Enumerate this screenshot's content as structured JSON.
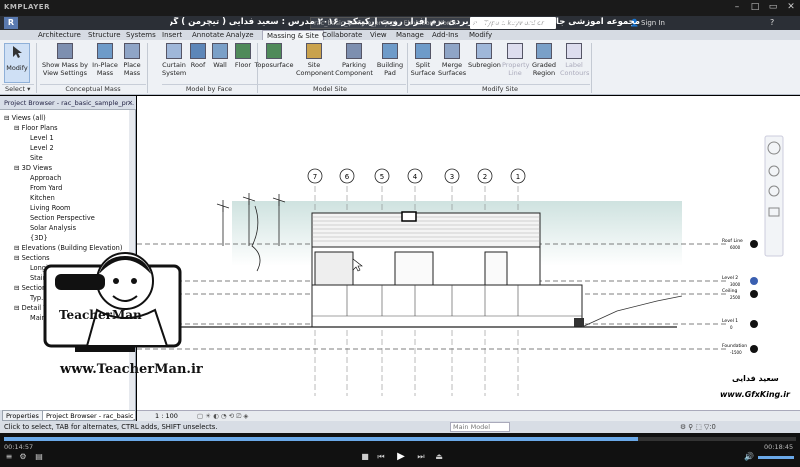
{
  "player": {
    "logo": "KMPLAYER",
    "elapsed": "00:14:57",
    "total": "00:18:45",
    "progress_fraction": 0.8
  },
  "title": {
    "text": "مجموعه آموزشی جامع ، گام به گام و کاربردی نرم افزار رویت آرکیتکچر ۲۰۱۶   مدرس : سعید فدایی ( تیچرمن ) گروه آموزشی پادشاه گرافیست ها",
    "file": "rac_basic_sample_project - Elevation: North",
    "search_placeholder": "Type a keyword or phrase",
    "sign_in": "Sign In"
  },
  "tabs": [
    "Architecture",
    "Structure",
    "Systems",
    "Insert",
    "Annotate",
    "Analyze",
    "Massing & Site",
    "Collaborate",
    "View",
    "Manage",
    "Add-Ins",
    "Modify"
  ],
  "active_tab": "Massing & Site",
  "ribbon": {
    "modify": "Modify",
    "select": "Select",
    "panels": [
      {
        "label": "Conceptual Mass",
        "buttons": [
          "Show Mass by View Settings",
          "In-Place Mass",
          "Place Mass"
        ]
      },
      {
        "label": "Model by Face",
        "buttons": [
          "Curtain System",
          "Roof",
          "Wall",
          "Floor"
        ]
      },
      {
        "label": "Model Site",
        "buttons": [
          "Toposurface",
          "Site Component",
          "Parking Component",
          "Building Pad"
        ]
      },
      {
        "label": "Modify Site",
        "buttons": [
          "Split Surface",
          "Merge Surfaces",
          "Subregion",
          "Property Line",
          "Graded Region",
          "Label Contours"
        ]
      }
    ]
  },
  "project_browser": {
    "header": "Project Browser - rac_basic_sample_pr...",
    "items": [
      {
        "label": "Views (all)",
        "level": 0
      },
      {
        "label": "Floor Plans",
        "level": 1
      },
      {
        "label": "Level 1",
        "level": 2
      },
      {
        "label": "Level 2",
        "level": 2
      },
      {
        "label": "Site",
        "level": 2
      },
      {
        "label": "3D Views",
        "level": 1
      },
      {
        "label": "Approach",
        "level": 2
      },
      {
        "label": "From Yard",
        "level": 2
      },
      {
        "label": "Kitchen",
        "level": 2
      },
      {
        "label": "Living Room",
        "level": 2
      },
      {
        "label": "Section Perspective",
        "level": 2
      },
      {
        "label": "Solar Analysis",
        "level": 2
      },
      {
        "label": "{3D}",
        "level": 2
      },
      {
        "label": "Elevations (Building Elevation)",
        "level": 1
      },
      {
        "label": "Sections",
        "level": 1
      },
      {
        "label": "Longitudinal",
        "level": 2
      },
      {
        "label": "Stair Section",
        "level": 2
      },
      {
        "label": "Sections (Wall Section)",
        "level": 1
      },
      {
        "label": "Typ...",
        "level": 2
      },
      {
        "label": "Detail Views (Detail)",
        "level": 1
      },
      {
        "label": "Main Stair Detail",
        "level": 2
      }
    ],
    "tab_properties": "Properties",
    "tab_browser": "Project Browser - rac_basic_..."
  },
  "view": {
    "scale": "1 : 100",
    "grid_labels": [
      "7",
      "6",
      "5",
      "4",
      "3",
      "2",
      "1"
    ],
    "levels": [
      "Roof Line",
      "Level 2",
      "Ceiling",
      "Level 1",
      "Foundation"
    ],
    "level_values": [
      "6000",
      "3000",
      "2500",
      "0",
      "-1500"
    ],
    "workset": "Main Model"
  },
  "status": {
    "text": "Click to select, TAB for alternates, CTRL adds, SHIFT unselects."
  },
  "overlay": {
    "brand": "TeacherMan",
    "url": "www.TeacherMan.ir",
    "persian_name": "سعید فدایی",
    "gfx_url": "www.GfxKing.ir"
  },
  "colors": {
    "ribbon_bg": "#eef1f5",
    "title_bg": "#2b2f36",
    "accent": "#6aa8e8"
  }
}
